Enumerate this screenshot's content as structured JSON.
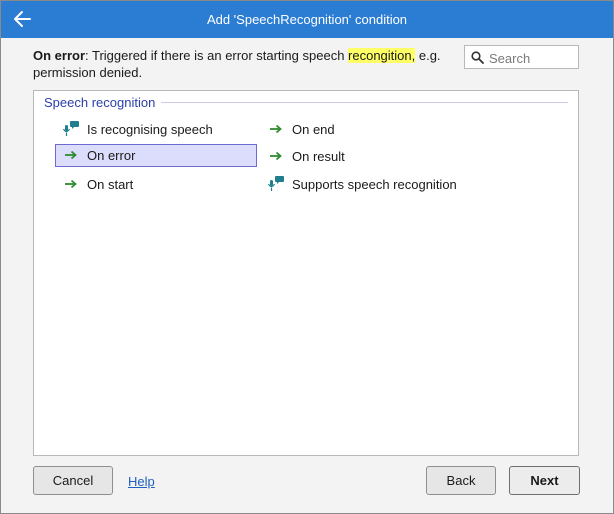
{
  "dialog": {
    "title": "Add 'SpeechRecognition' condition",
    "back_icon": "arrow-left-icon"
  },
  "description": {
    "name": "On error",
    "text_before": ": Triggered if there is an error starting speech ",
    "highlight": "recongition,",
    "text_after": " e.g. permission denied."
  },
  "search": {
    "placeholder": "Search",
    "value": "",
    "icon": "search-icon"
  },
  "group": {
    "title": "Speech recognition"
  },
  "conditions": [
    {
      "label": "Is recognising speech",
      "icon": "speech-recognition-icon"
    },
    {
      "label": "On error",
      "icon": "trigger-arrow-icon",
      "selected": true
    },
    {
      "label": "On start",
      "icon": "trigger-arrow-icon"
    },
    {
      "label": "On end",
      "icon": "trigger-arrow-icon"
    },
    {
      "label": "On result",
      "icon": "trigger-arrow-icon"
    },
    {
      "label": "Supports speech recognition",
      "icon": "speech-recognition-icon"
    }
  ],
  "footer": {
    "cancel_label": "Cancel",
    "help_label": "Help",
    "back_label": "Back",
    "next_label": "Next"
  },
  "colors": {
    "titlebar": "#2b7cd3",
    "trigger_green": "#2e8b2e",
    "speech_teal": "#1f7f8f",
    "highlight": "#ffff66",
    "selection_bg": "#dcdcfc"
  }
}
